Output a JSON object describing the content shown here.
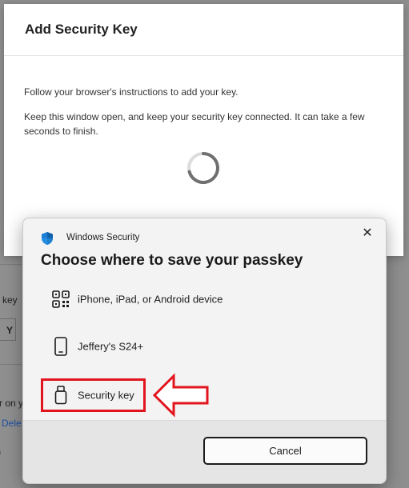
{
  "background_page": {
    "fragments": [
      "key",
      "Y",
      "r on y",
      "Dele",
      ")"
    ]
  },
  "add_security_key_dialog": {
    "title": "Add Security Key",
    "instruction": "Follow your browser's instructions to add your key.",
    "note": "Keep this window open, and keep your security key connected. It can take a few seconds to finish."
  },
  "windows_security_dialog": {
    "header_label": "Windows Security",
    "title": "Choose where to save your passkey",
    "options": [
      {
        "label": "iPhone, iPad, or Android device",
        "icon": "qr-code-icon"
      },
      {
        "label": "Jeffery's S24+",
        "icon": "phone-icon"
      },
      {
        "label": "Security key",
        "icon": "usb-key-icon"
      }
    ],
    "cancel_label": "Cancel",
    "close_icon": "close-icon"
  },
  "colors": {
    "highlight": "#e2141d",
    "accent_blue": "#1b7fd6",
    "overlay": "#8f8f8f"
  }
}
